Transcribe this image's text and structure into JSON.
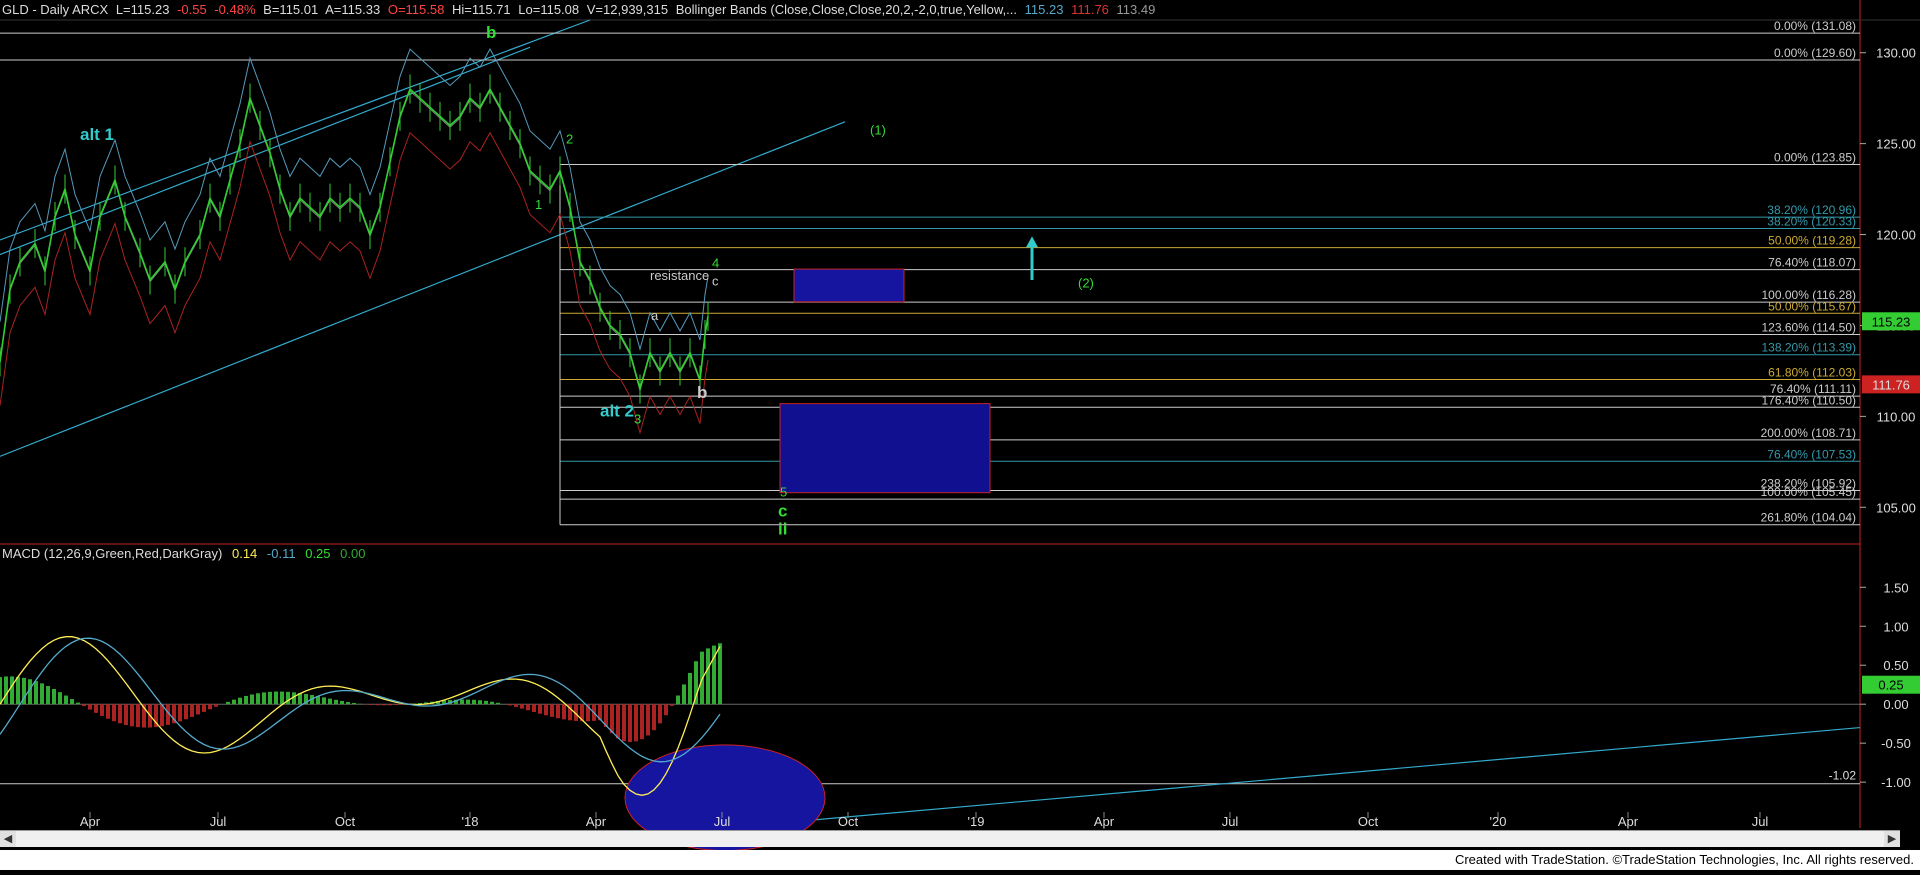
{
  "header": {
    "symbol": "GLD - Daily  ARCX",
    "last": "L=115.23",
    "chg": "-0.55",
    "pct": "-0.48%",
    "bid": "B=115.01",
    "ask": "A=115.33",
    "open": "O=115.58",
    "hi": "Hi=115.71",
    "lo": "Lo=115.08",
    "vol": "V=12,939,315",
    "bb": "Bollinger Bands (Close,Close,Close,20,2,-2,0,true,Yellow,...",
    "bb_v1": "115.23",
    "bb_v2": "111.76",
    "bb_v3": "113.49"
  },
  "macd_header": {
    "label": "MACD (12,26,9,Green,Red,DarkGray)",
    "v1": "0.14",
    "v2": "-0.11",
    "v3": "0.25",
    "v4": "0.00"
  },
  "footer": "Created with TradeStation. ©TradeStation Technologies, Inc. All rights reserved.",
  "chart_data": [
    {
      "type": "line",
      "name": "price",
      "y_axis_ticks": [
        105,
        110,
        115,
        120,
        125,
        130
      ],
      "y_tick_labels": [
        "105.00",
        "110.00",
        "115.00",
        "120.00",
        "125.00",
        "130.00"
      ],
      "ylim": [
        103.2,
        131.8
      ],
      "x_tick_labels": [
        "Apr",
        "Jul",
        "Oct",
        "'18",
        "Apr",
        "Jul",
        "Oct",
        "'19",
        "Apr",
        "Jul",
        "Oct",
        "'20",
        "Apr",
        "Jul"
      ],
      "last_price_label": "115.23",
      "lower_band_label": "111.76",
      "price_path": [
        [
          0,
          113
        ],
        [
          10,
          117
        ],
        [
          20,
          118.5
        ],
        [
          35,
          119.5
        ],
        [
          45,
          118
        ],
        [
          55,
          121
        ],
        [
          65,
          122.5
        ],
        [
          75,
          120
        ],
        [
          90,
          118
        ],
        [
          100,
          121
        ],
        [
          115,
          123
        ],
        [
          125,
          121
        ],
        [
          140,
          119
        ],
        [
          150,
          117.5
        ],
        [
          165,
          118.5
        ],
        [
          175,
          117
        ],
        [
          185,
          118.5
        ],
        [
          200,
          120
        ],
        [
          210,
          122
        ],
        [
          220,
          121
        ],
        [
          230,
          123
        ],
        [
          240,
          125
        ],
        [
          250,
          127.5
        ],
        [
          260,
          126
        ],
        [
          270,
          124.5
        ],
        [
          280,
          122.5
        ],
        [
          290,
          121
        ],
        [
          300,
          122
        ],
        [
          310,
          121.5
        ],
        [
          320,
          121
        ],
        [
          330,
          122
        ],
        [
          340,
          121.5
        ],
        [
          350,
          122
        ],
        [
          360,
          121.5
        ],
        [
          370,
          120
        ],
        [
          380,
          121.5
        ],
        [
          390,
          124
        ],
        [
          400,
          126.5
        ],
        [
          410,
          128
        ],
        [
          420,
          127.5
        ],
        [
          430,
          127
        ],
        [
          440,
          126.5
        ],
        [
          450,
          126
        ],
        [
          460,
          126.5
        ],
        [
          470,
          127.5
        ],
        [
          480,
          127
        ],
        [
          490,
          128
        ],
        [
          500,
          127
        ],
        [
          510,
          126
        ],
        [
          520,
          125
        ],
        [
          530,
          123.5
        ],
        [
          540,
          123
        ],
        [
          550,
          122.5
        ],
        [
          560,
          123.5
        ],
        [
          570,
          121.5
        ],
        [
          580,
          118.5
        ],
        [
          590,
          117.5
        ],
        [
          600,
          116
        ],
        [
          610,
          115
        ],
        [
          620,
          114.5
        ],
        [
          630,
          113.5
        ],
        [
          640,
          111.5
        ],
        [
          650,
          113.5
        ],
        [
          660,
          112.5
        ],
        [
          670,
          113.5
        ],
        [
          680,
          112.5
        ],
        [
          690,
          113.5
        ],
        [
          700,
          112
        ],
        [
          705,
          114.5
        ],
        [
          708,
          115.5
        ]
      ],
      "fib_levels": [
        {
          "label": "0.00% (131.08)",
          "value": 131.08
        },
        {
          "label": "0.00% (129.60)",
          "value": 129.6
        },
        {
          "label": "0.00% (123.85)",
          "value": 123.85
        },
        {
          "label": "38.20% (120.96)",
          "value": 120.96
        },
        {
          "label": "38.20% (120.33)",
          "value": 120.33
        },
        {
          "label": "50.00% (119.28)",
          "value": 119.28
        },
        {
          "label": "76.40% (118.07)",
          "value": 118.07
        },
        {
          "label": "100.00% (116.28)",
          "value": 116.28
        },
        {
          "label": "50.00% (115.67)",
          "value": 115.67
        },
        {
          "label": "123.60% (114.50)",
          "value": 114.5
        },
        {
          "label": "138.20% (113.39)",
          "value": 113.39
        },
        {
          "label": "61.80% (112.03)",
          "value": 112.03
        },
        {
          "label": "76.40% (111.11)",
          "value": 111.11
        },
        {
          "label": "176.40% (110.50)",
          "value": 110.5
        },
        {
          "label": "200.00% (108.71)",
          "value": 108.71
        },
        {
          "label": "76.40% (107.53)",
          "value": 107.53
        },
        {
          "label": "238.20% (105.92)",
          "value": 105.92
        },
        {
          "label": "100.00% (105.45)",
          "value": 105.45
        },
        {
          "label": "261.80% (104.04)",
          "value": 104.04
        }
      ],
      "annotations": [
        {
          "text": "b",
          "color": "#33dd33",
          "value": 130.8,
          "xi": 486
        },
        {
          "text": "alt 1",
          "color": "#33cccc",
          "value": 125.2,
          "xi": 80
        },
        {
          "text": "2",
          "color": "#33dd33",
          "value": 125.0,
          "xi": 566
        },
        {
          "text": "1",
          "color": "#33dd33",
          "value": 121.4,
          "xi": 535
        },
        {
          "text": "(1)",
          "color": "#33dd33",
          "value": 125.5,
          "xi": 870
        },
        {
          "text": "4",
          "color": "#33dd33",
          "value": 118.2,
          "xi": 712
        },
        {
          "text": "c",
          "color": "#cccccc",
          "value": 117.2,
          "xi": 712
        },
        {
          "text": "resistance",
          "color": "#cccccc",
          "value": 117.5,
          "xi": 650
        },
        {
          "text": "(2)",
          "color": "#33dd33",
          "value": 117.1,
          "xi": 1078
        },
        {
          "text": "a",
          "color": "#cccccc",
          "value": 115.3,
          "xi": 651
        },
        {
          "text": "b",
          "color": "#cccccc",
          "value": 111.0,
          "xi": 697
        },
        {
          "text": "alt 2",
          "color": "#33cccc",
          "value": 110.0,
          "xi": 600
        },
        {
          "text": "3",
          "color": "#33dd33",
          "value": 109.6,
          "xi": 634
        },
        {
          "text": "5",
          "color": "#33dd33",
          "value": 105.6,
          "xi": 780
        },
        {
          "text": "c",
          "color": "#33dd33",
          "value": 104.5,
          "xi": 778
        },
        {
          "text": "ii",
          "color": "#33dd33",
          "value": 103.5,
          "xi": 778
        }
      ]
    },
    {
      "type": "line",
      "name": "MACD",
      "y_axis_ticks": [
        1.5,
        1.0,
        0.5,
        0.0,
        -0.5,
        -1.0
      ],
      "y_tick_labels": [
        "1.50",
        "1.00",
        "0.50",
        "0.00",
        "-0.50",
        "-1.00"
      ],
      "ylim": [
        -1.55,
        1.85
      ],
      "current_label": "0.25",
      "hline_label": "-1.02",
      "hline_value": -1.02
    }
  ]
}
